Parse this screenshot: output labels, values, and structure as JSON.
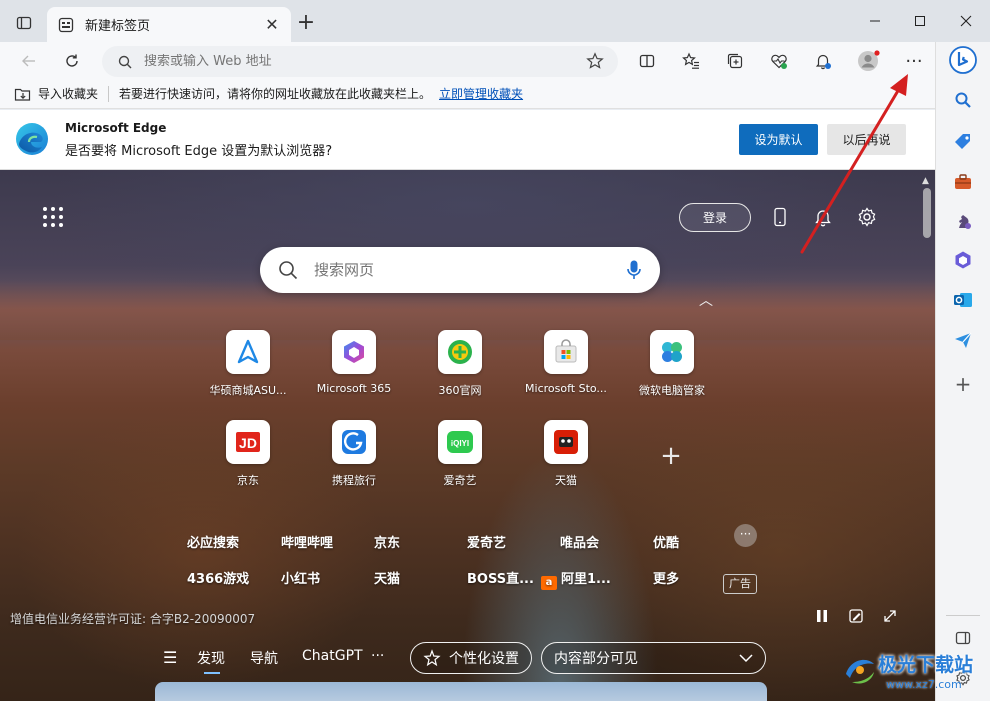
{
  "tab": {
    "title": "新建标签页"
  },
  "address_bar": {
    "placeholder": "搜索或输入 Web 地址"
  },
  "favorites_bar": {
    "import_label": "导入收藏夹",
    "hint": "若要进行快速访问，请将你的网址收藏放在此收藏夹栏上。",
    "manage_link": "立即管理收藏夹"
  },
  "banner": {
    "title": "Microsoft Edge",
    "message": "是否要将 Microsoft Edge 设置为默认浏览器?",
    "primary_button": "设为默认",
    "secondary_button": "以后再说"
  },
  "page": {
    "login_button": "登录",
    "search_placeholder": "搜索网页",
    "tiles": [
      {
        "label": "华硕商城ASU...",
        "icon": "asus-icon"
      },
      {
        "label": "Microsoft 365",
        "icon": "m365-icon"
      },
      {
        "label": "360官网",
        "icon": "360-icon"
      },
      {
        "label": "Microsoft Sto...",
        "icon": "store-icon"
      },
      {
        "label": "微软电脑管家",
        "icon": "pc-manager-icon"
      },
      {
        "label": "京东",
        "icon": "jd-icon"
      },
      {
        "label": "携程旅行",
        "icon": "ctrip-icon"
      },
      {
        "label": "爱奇艺",
        "icon": "iqiyi-icon"
      },
      {
        "label": "天猫",
        "icon": "tmall-icon"
      }
    ],
    "quick_links_row1": [
      "必应搜索",
      "哔哩哔哩",
      "京东",
      "爱奇艺",
      "唯品会",
      "优酷"
    ],
    "quick_links_row2": [
      "4366游戏",
      "小红书",
      "天猫",
      "BOSS直...",
      "阿里1...",
      "更多"
    ],
    "ad_badge": "广告",
    "license": "增值电信业务经营许可证: 合字B2-20090007",
    "feed_nav": [
      "发现",
      "导航",
      "ChatGPT",
      "···"
    ],
    "personalize_button": "个性化设置",
    "content_visibility": "内容部分可见"
  },
  "watermark": {
    "text": "极光下载站",
    "url": "www.xz7.com"
  },
  "colors": {
    "accent": "#0f6cbd",
    "link": "#0050b8",
    "annotation": "#d42020"
  }
}
